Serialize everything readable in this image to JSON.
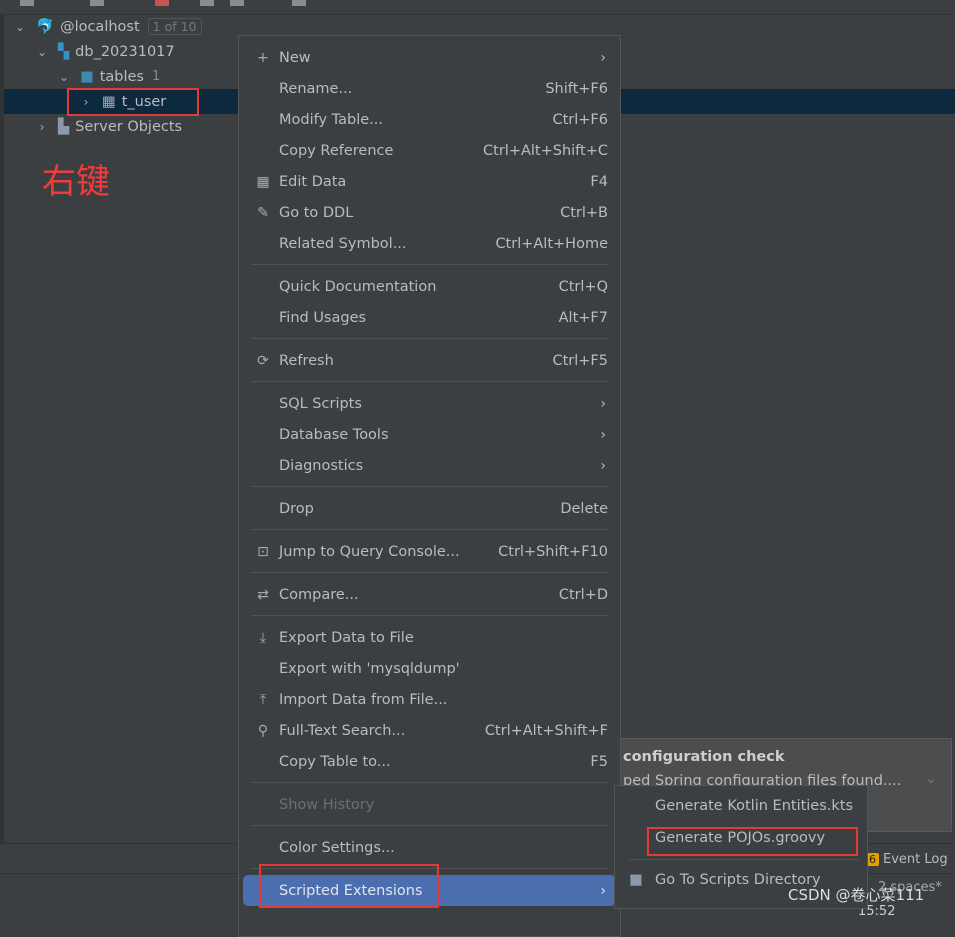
{
  "tree": {
    "host": {
      "label": "@localhost",
      "badge": "1 of 10"
    },
    "db": {
      "label": "db_20231017"
    },
    "tables": {
      "label": "tables",
      "count": "1"
    },
    "table": {
      "label": "t_user"
    },
    "server": {
      "label": "Server Objects"
    }
  },
  "annotation": "右键",
  "menu": [
    {
      "label": "New",
      "icon": "plus-icon",
      "submenu": true
    },
    {
      "label": "Rename...",
      "shortcut": "Shift+F6"
    },
    {
      "label": "Modify Table...",
      "shortcut": "Ctrl+F6"
    },
    {
      "label": "Copy Reference",
      "shortcut": "Ctrl+Alt+Shift+C"
    },
    {
      "label": "Edit Data",
      "shortcut": "F4",
      "icon": "table-icon"
    },
    {
      "label": "Go to DDL",
      "shortcut": "Ctrl+B",
      "icon": "pencil-icon"
    },
    {
      "label": "Related Symbol...",
      "shortcut": "Ctrl+Alt+Home"
    },
    {
      "separator": true
    },
    {
      "label": "Quick Documentation",
      "shortcut": "Ctrl+Q"
    },
    {
      "label": "Find Usages",
      "shortcut": "Alt+F7"
    },
    {
      "separator": true
    },
    {
      "label": "Refresh",
      "shortcut": "Ctrl+F5",
      "icon": "refresh-icon"
    },
    {
      "separator": true
    },
    {
      "label": "SQL Scripts",
      "submenu": true
    },
    {
      "label": "Database Tools",
      "submenu": true
    },
    {
      "label": "Diagnostics",
      "submenu": true
    },
    {
      "separator": true
    },
    {
      "label": "Drop",
      "shortcut": "Delete"
    },
    {
      "separator": true
    },
    {
      "label": "Jump to Query Console...",
      "shortcut": "Ctrl+Shift+F10",
      "icon": "console-icon"
    },
    {
      "separator": true
    },
    {
      "label": "Compare...",
      "shortcut": "Ctrl+D",
      "icon": "compare-icon"
    },
    {
      "separator": true
    },
    {
      "label": "Export Data to File",
      "icon": "export-icon"
    },
    {
      "label": "Export with 'mysqldump'"
    },
    {
      "label": "Import Data from File...",
      "icon": "import-icon"
    },
    {
      "label": "Full-Text Search...",
      "shortcut": "Ctrl+Alt+Shift+F",
      "icon": "search-icon"
    },
    {
      "label": "Copy Table to...",
      "shortcut": "F5"
    },
    {
      "separator": true
    },
    {
      "label": "Show History",
      "disabled": true
    },
    {
      "separator": true
    },
    {
      "label": "Color Settings..."
    },
    {
      "separator": true
    },
    {
      "label": "Scripted Extensions",
      "submenu": true,
      "highlighted": true
    }
  ],
  "submenu": {
    "items": [
      "Generate Kotlin Entities.kts",
      "Generate POJOs.groovy"
    ],
    "scripts_dir": "Go To Scripts Directory"
  },
  "notification": {
    "title": "configuration check",
    "body": "ped Spring configuration files found...."
  },
  "event_log": {
    "count": "6",
    "label": "Event Log"
  },
  "status": {
    "indent": "2 spaces*",
    "time": "15:52"
  },
  "watermark": "CSDN @卷心菜111",
  "colors": {
    "highlight": "#4b6eaf",
    "selection": "#0d293e",
    "annotation": "#e53935"
  }
}
